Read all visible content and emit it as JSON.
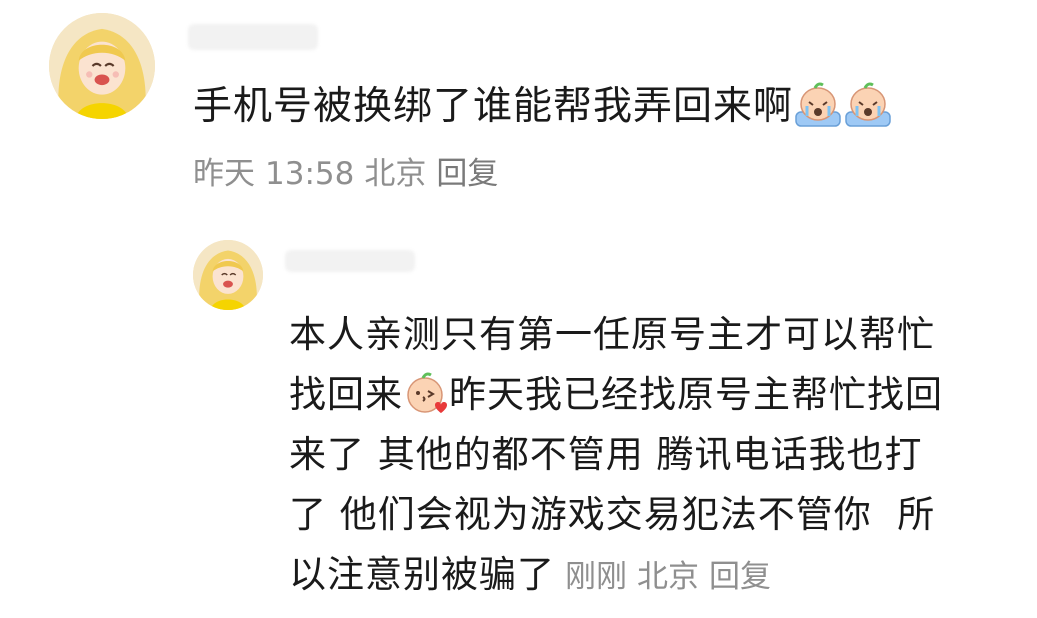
{
  "comment": {
    "text": "手机号被换绑了谁能帮我弄回来啊",
    "emojis": [
      "crying-face-emoji",
      "crying-face-emoji"
    ],
    "date": "昨天",
    "time": "13:58",
    "location": "北京",
    "reply_label": "回复"
  },
  "reply": {
    "line1": "本人亲测只有第一任原号主才可以帮忙",
    "line2a": "找回来",
    "line2_emoji": "kiss-face-emoji",
    "line2b": "昨天我已经找原号主帮忙找回",
    "line3": "来了 其他的都不管用 腾讯电话我也打",
    "line4": "了 他们会视为游戏交易犯法不管你  所",
    "line5": "以注意别被骗了",
    "time": "刚刚",
    "location": "北京",
    "reply_label": "回复"
  }
}
